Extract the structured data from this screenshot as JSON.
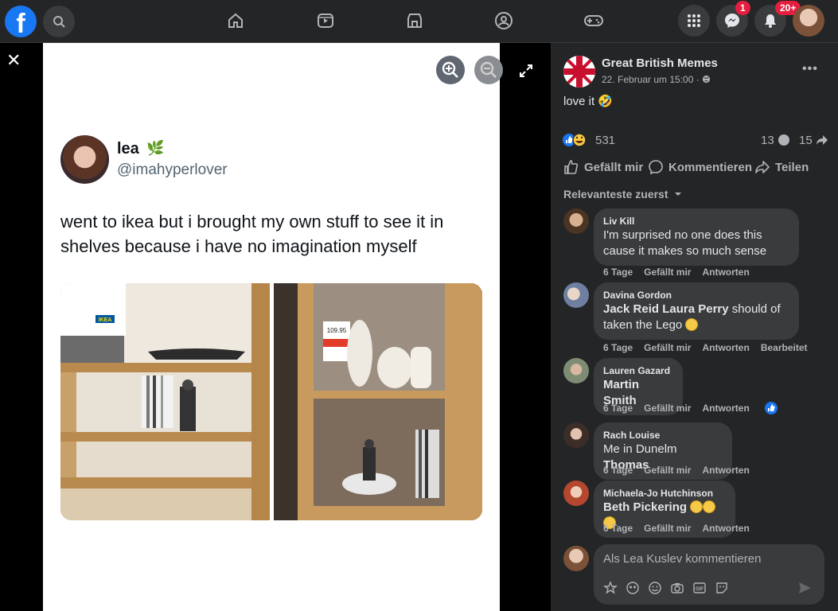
{
  "topbar": {
    "logo": "f",
    "icons": [
      "search-icon",
      "home-icon",
      "video-icon",
      "marketplace-icon",
      "groups-icon",
      "gaming-icon",
      "menu-grid-icon",
      "messenger-icon",
      "bell-icon"
    ],
    "messenger_badge": "1",
    "notifications_badge": "20+"
  },
  "viewer": {
    "close": "✕"
  },
  "tweet": {
    "name": "lea",
    "leaf": "🌿",
    "handle": "@imahyperlover",
    "text": "went to ikea but i brought my own stuff to see it in shelves because i have no imagination myself",
    "ikea_label": "IKEA",
    "price_tag": "109.95"
  },
  "post": {
    "page_name": "Great British Memes",
    "date": "22. Februar um 15:00 ·",
    "caption": "love it",
    "caption_emoji": "🤣",
    "reaction_count": "531",
    "comment_count": "13",
    "share_count": "15",
    "like_label": "Gefällt mir",
    "comment_label": "Kommentieren",
    "share_label": "Teilen",
    "sort_label": "Relevanteste zuerst"
  },
  "comments": [
    {
      "author": "Liv Kill",
      "text_line1": "I'm surprised no one does this",
      "text_line2": "cause it makes so much sense",
      "time": "6 Tage",
      "like": "Gefällt mir",
      "reply": "Antworten"
    },
    {
      "author": "Davina Gordon",
      "tag1": "Jack Reid",
      "tag2": "Laura Perry",
      "text_rest": "should of",
      "text_line2": "taken the Lego",
      "time": "6 Tage",
      "like": "Gefällt mir",
      "reply": "Antworten",
      "edited": "Bearbeitet"
    },
    {
      "author": "Lauren Gazard",
      "tag1": "Martin Smith",
      "time": "6 Tage",
      "like": "Gefällt mir",
      "reply": "Antworten"
    },
    {
      "author": "Rach Louise",
      "text_pre": "Me in Dunelm",
      "tag1": "Thomas",
      "time": "6 Tage",
      "like": "Gefällt mir",
      "reply": "Antworten"
    },
    {
      "author": "Michaela-Jo Hutchinson",
      "tag1": "Beth Pickering",
      "time": "6 Tage",
      "like": "Gefällt mir",
      "reply": "Antworten"
    }
  ],
  "composer": {
    "placeholder": "Als Lea Kuslev kommentieren"
  }
}
